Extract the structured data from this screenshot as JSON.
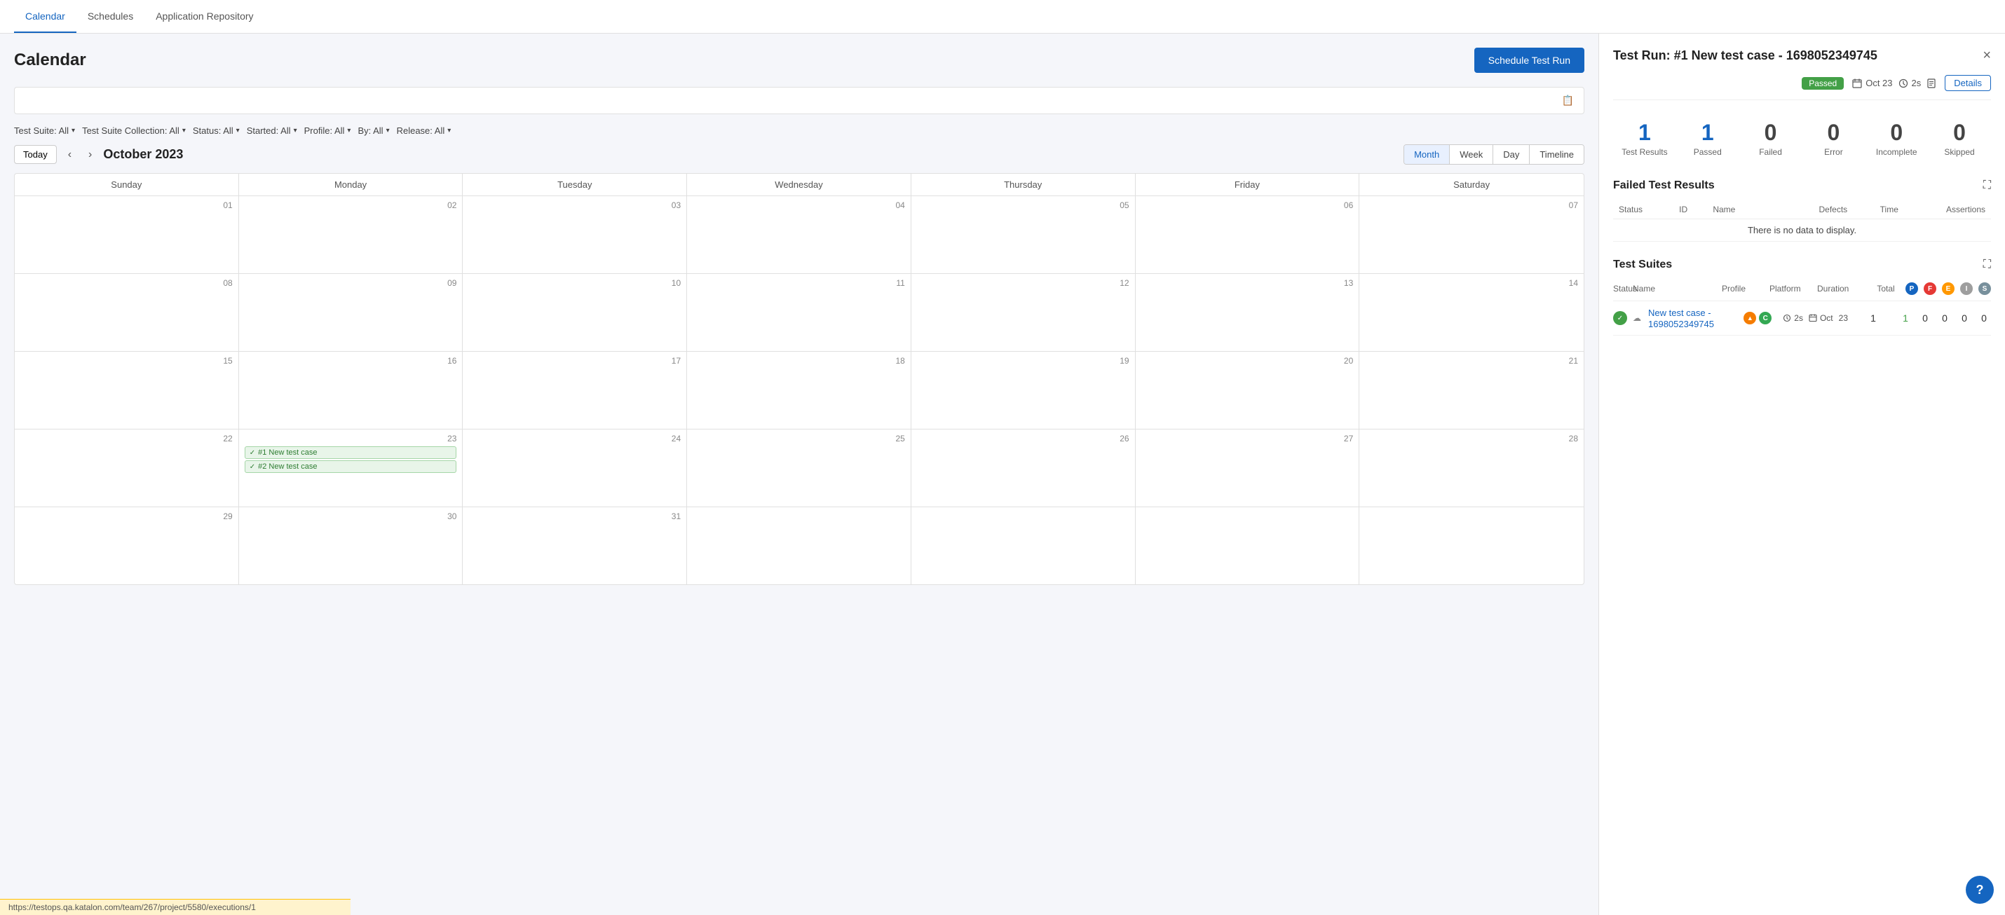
{
  "nav": {
    "tabs": [
      {
        "label": "Calendar",
        "active": true
      },
      {
        "label": "Schedules",
        "active": false
      },
      {
        "label": "Application Repository",
        "active": false
      }
    ]
  },
  "page": {
    "title": "Calendar",
    "schedule_btn": "Schedule Test Run"
  },
  "filters": {
    "search_placeholder": "",
    "copy_icon": "copy",
    "items": [
      {
        "label": "Test Suite: All"
      },
      {
        "label": "Test Suite Collection: All"
      },
      {
        "label": "Status: All"
      },
      {
        "label": "Started: All"
      },
      {
        "label": "Profile: All"
      },
      {
        "label": "By: All"
      },
      {
        "label": "Release: All"
      }
    ]
  },
  "calendar": {
    "today_btn": "Today",
    "month_title": "October 2023",
    "views": [
      "Month",
      "Week",
      "Day",
      "Timeline"
    ],
    "active_view": "Month",
    "day_headers": [
      "Sunday",
      "Monday",
      "Tuesday",
      "Wednesday",
      "Thursday",
      "Friday",
      "Saturday"
    ],
    "weeks": [
      [
        {
          "date": "01",
          "events": []
        },
        {
          "date": "02",
          "events": []
        },
        {
          "date": "03",
          "events": []
        },
        {
          "date": "04",
          "events": []
        },
        {
          "date": "05",
          "events": []
        },
        {
          "date": "06",
          "events": []
        },
        {
          "date": "07",
          "events": []
        }
      ],
      [
        {
          "date": "08",
          "events": []
        },
        {
          "date": "09",
          "events": []
        },
        {
          "date": "10",
          "events": []
        },
        {
          "date": "11",
          "events": []
        },
        {
          "date": "12",
          "events": []
        },
        {
          "date": "13",
          "events": []
        },
        {
          "date": "14",
          "events": []
        }
      ],
      [
        {
          "date": "15",
          "events": []
        },
        {
          "date": "16",
          "events": []
        },
        {
          "date": "17",
          "events": []
        },
        {
          "date": "18",
          "events": []
        },
        {
          "date": "19",
          "events": []
        },
        {
          "date": "20",
          "events": []
        },
        {
          "date": "21",
          "events": []
        }
      ],
      [
        {
          "date": "22",
          "events": []
        },
        {
          "date": "23",
          "events": [
            {
              "label": "#1 New test case",
              "status": "passed"
            },
            {
              "label": "#2 New test case",
              "status": "passed"
            }
          ]
        },
        {
          "date": "24",
          "events": []
        },
        {
          "date": "25",
          "events": []
        },
        {
          "date": "26",
          "events": []
        },
        {
          "date": "27",
          "events": []
        },
        {
          "date": "28",
          "events": []
        }
      ],
      [
        {
          "date": "29",
          "events": []
        },
        {
          "date": "30",
          "events": []
        },
        {
          "date": "31",
          "events": []
        },
        {
          "date": "",
          "events": []
        },
        {
          "date": "",
          "events": []
        },
        {
          "date": "",
          "events": []
        },
        {
          "date": "",
          "events": []
        }
      ]
    ]
  },
  "right_panel": {
    "title": "Test Run: #1 New test case - 1698052349745",
    "close_btn": "×",
    "status_badge": "Passed",
    "meta_date": "Oct 23",
    "meta_time": "2s",
    "details_btn": "Details",
    "stats": [
      {
        "value": "1",
        "label": "Test Results"
      },
      {
        "value": "1",
        "label": "Passed"
      },
      {
        "value": "0",
        "label": "Failed"
      },
      {
        "value": "0",
        "label": "Error"
      },
      {
        "value": "0",
        "label": "Incomplete"
      },
      {
        "value": "0",
        "label": "Skipped"
      }
    ],
    "failed_section": {
      "title": "Failed Test Results",
      "columns": [
        "Status",
        "ID",
        "Name",
        "",
        "Defects",
        "Time",
        "Assertions"
      ],
      "no_data": "There is no data to display."
    },
    "suites_section": {
      "title": "Test Suites",
      "headers": {
        "status": "Status",
        "name": "Name",
        "profile": "Profile",
        "platform": "Platform",
        "duration": "Duration",
        "total": "Total",
        "p": "P",
        "f": "F",
        "e": "E",
        "i": "I",
        "s": "S"
      },
      "rows": [
        {
          "status": "passed",
          "name": "New test case - 1698052349745",
          "profile_icon1": "triangle",
          "profile_icon2": "chrome",
          "duration": "2s",
          "date": "Oct",
          "date2": "23",
          "total": "1",
          "p": "1",
          "f": "0",
          "e": "0",
          "i": "0",
          "s": "0"
        }
      ]
    }
  },
  "bottom_tooltip": "https://testops.qa.katalon.com/team/267/project/5580/executions/1",
  "support_btn": "?"
}
